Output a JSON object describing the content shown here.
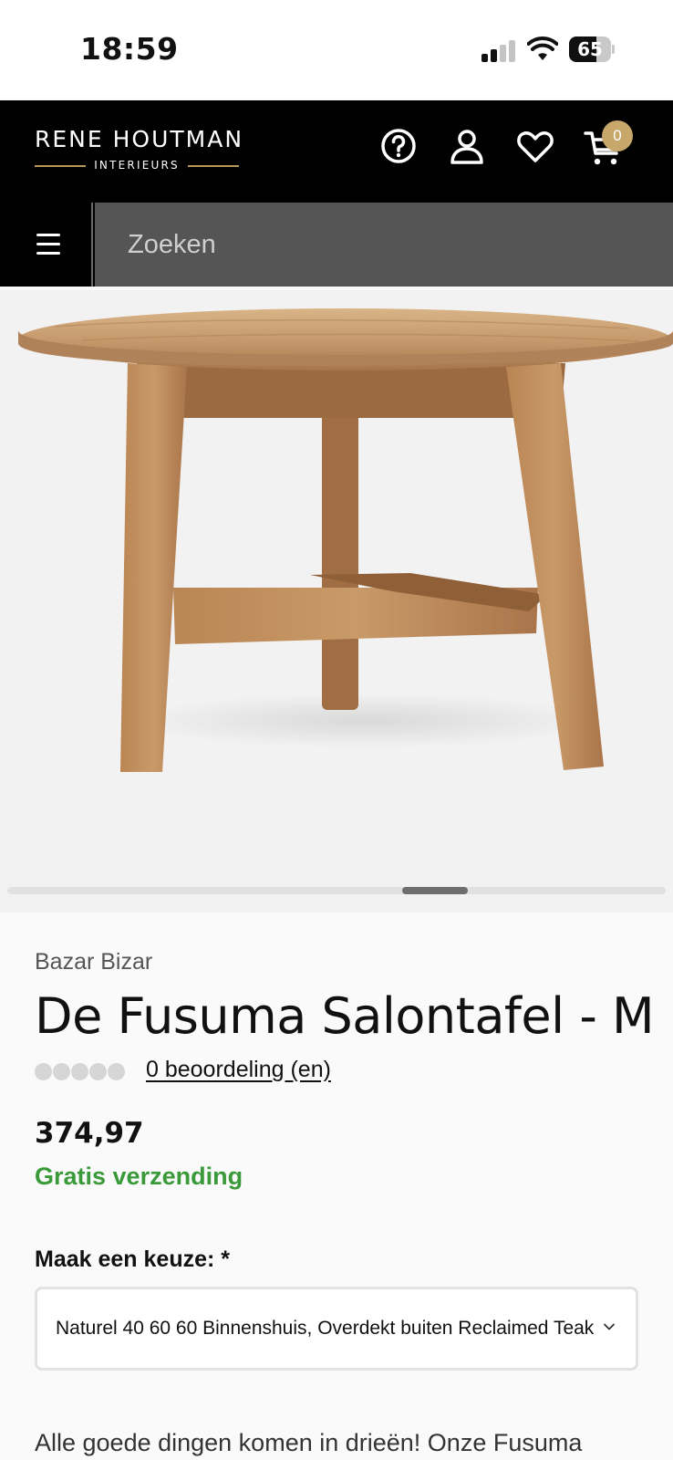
{
  "status_bar": {
    "time": "18:59",
    "battery": "65",
    "battery_level": 0.65
  },
  "header": {
    "logo_main": "RENE HOUTMAN",
    "logo_sub": "INTERIEURS",
    "icons": [
      "help-icon",
      "account-icon",
      "wishlist-heart-icon",
      "cart-icon"
    ],
    "cart_count": "0",
    "accent_color": "#c7a76a"
  },
  "search": {
    "placeholder": "Zoeken"
  },
  "product": {
    "brand": "Bazar Bizar",
    "title": "De Fusuma Salontafel - M",
    "rating_count_text": "0 beoordeling (en)",
    "rating_value": 0,
    "price": "374,97",
    "shipping": "Gratis verzending",
    "shipping_color": "#3a9a3a",
    "choice_label": "Maak een keuze: *",
    "selected_option": "Naturel 40 60 60 Binnenshuis, Overdekt buiten Reclaimed Teak",
    "description": "Alle goede dingen komen in drieën! Onze Fusuma"
  }
}
